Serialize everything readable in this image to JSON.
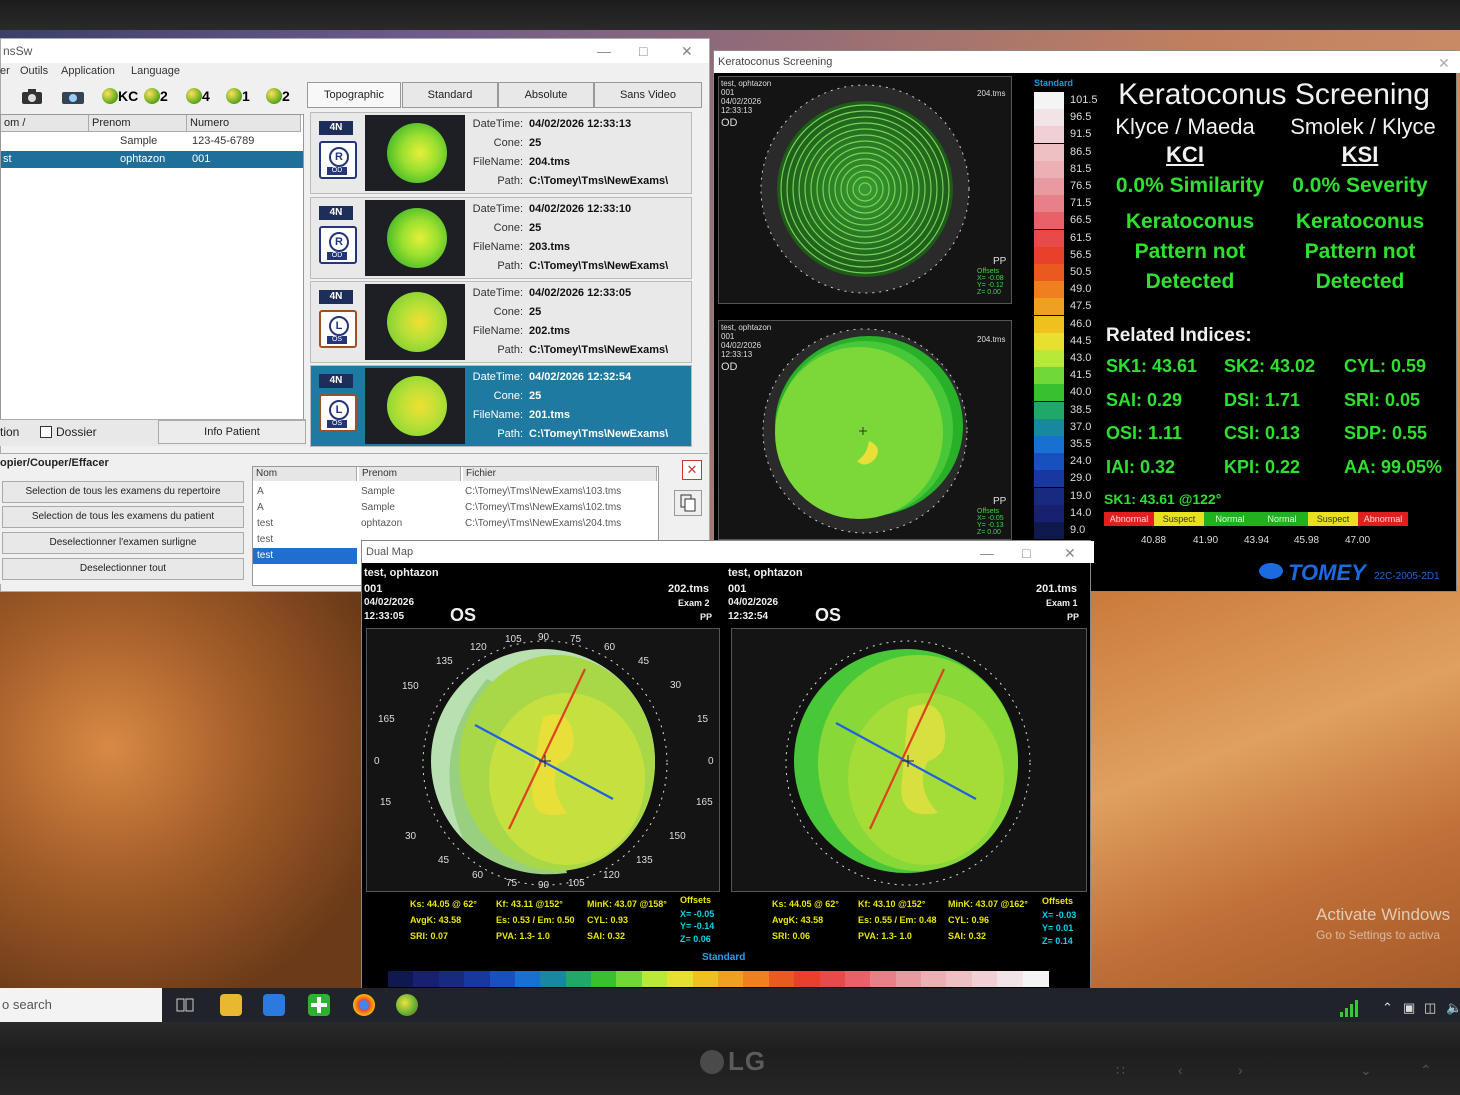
{
  "main_window": {
    "title": "nsSw",
    "menu": [
      "er",
      "Outils",
      "Application",
      "Language"
    ],
    "toolbar": [
      "KC",
      "2",
      "4",
      "1",
      "2"
    ],
    "patient_table": {
      "headers": [
        "om /",
        "Prenom",
        "Numero"
      ],
      "rows": [
        {
          "nom": "",
          "prenom": "Sample",
          "numero": "123-45-6789"
        },
        {
          "nom": "st",
          "prenom": "ophtazon",
          "numero": "001"
        }
      ]
    },
    "tabs": [
      "Topographic",
      "Standard",
      "Absolute",
      "Sans Video"
    ],
    "exams": [
      {
        "badge": "4N",
        "eye": "R",
        "side": "OD",
        "datetime": "04/02/2026 12:33:13",
        "cone": "25",
        "filename": "204.tms",
        "path": "C:\\Tomey\\Tms\\NewExams\\"
      },
      {
        "badge": "4N",
        "eye": "R",
        "side": "OD",
        "datetime": "04/02/2026 12:33:10",
        "cone": "25",
        "filename": "203.tms",
        "path": "C:\\Tomey\\Tms\\NewExams\\"
      },
      {
        "badge": "4N",
        "eye": "L",
        "side": "OS",
        "datetime": "04/02/2026 12:33:05",
        "cone": "25",
        "filename": "202.tms",
        "path": "C:\\Tomey\\Tms\\NewExams\\"
      },
      {
        "badge": "4N",
        "eye": "L",
        "side": "OS",
        "datetime": "04/02/2026 12:32:54",
        "cone": "25",
        "filename": "201.tms",
        "path": "C:\\Tomey\\Tms\\NewExams\\"
      }
    ],
    "exam_labels": {
      "datetime": "DateTime:",
      "cone": "Cone:",
      "filename": "FileName:",
      "path": "Path:"
    },
    "bottom_bar": {
      "left": "tion",
      "dossier": "Dossier",
      "info": "Info Patient"
    },
    "actions_title": "opier/Couper/Effacer",
    "actions": [
      "Selection de tous les examens du repertoire",
      "Selection de tous les examens du patient",
      "Deselectionner l'examen surligne",
      "Deselectionner tout"
    ],
    "file_table": {
      "headers": [
        "Nom",
        "Prenom",
        "Fichier"
      ],
      "rows": [
        {
          "nom": "A",
          "prenom": "Sample",
          "fichier": "C:\\Tomey\\Tms\\NewExams\\103.tms"
        },
        {
          "nom": "A",
          "prenom": "Sample",
          "fichier": "C:\\Tomey\\Tms\\NewExams\\102.tms"
        },
        {
          "nom": "test",
          "prenom": "ophtazon",
          "fichier": "C:\\Tomey\\Tms\\NewExams\\204.tms"
        },
        {
          "nom": "test",
          "prenom": "",
          "fichier": ""
        },
        {
          "nom": "test",
          "prenom": "",
          "fichier": ""
        }
      ]
    }
  },
  "ks_window": {
    "title": "Keratoconus Screening",
    "map_top": {
      "name": "test, ophtazon",
      "id": "001",
      "date": "04/02/2026",
      "time": "12:33:13",
      "eye": "OD",
      "file": "204.tms",
      "offsets": "Offsets",
      "x": "X= -0.08",
      "y": "Y= -0.12",
      "z": "Z= 0.00",
      "pp": "PP"
    },
    "map_bottom": {
      "name": "test, ophtazon",
      "id": "001",
      "date": "04/02/2026",
      "time": "12:33:13",
      "eye": "OD",
      "file": "204.tms",
      "offsets": "Offsets",
      "x": "X= -0.05",
      "y": "Y= -0.13",
      "z": "Z= 0.00",
      "pp": "PP"
    },
    "scale_label": "Standard",
    "scale_values": [
      "101.5",
      "96.5",
      "91.5",
      "86.5",
      "81.5",
      "76.5",
      "71.5",
      "66.5",
      "61.5",
      "56.5",
      "50.5",
      "49.0",
      "47.5",
      "46.0",
      "44.5",
      "43.0",
      "41.5",
      "40.0",
      "38.5",
      "37.0",
      "35.5",
      "24.0",
      "29.0",
      "19.0",
      "14.0",
      "9.0"
    ],
    "scale_colors": [
      "#f4f4f4",
      "#f2e4e6",
      "#f0d0d4",
      "#eec0c4",
      "#ecb0b4",
      "#e89aa0",
      "#e88088",
      "#e86068",
      "#e84a4a",
      "#e8402a",
      "#ea5a20",
      "#ee8020",
      "#f0a020",
      "#f0c020",
      "#e8e030",
      "#b8e838",
      "#70d838",
      "#38c030",
      "#20a868",
      "#1888a0",
      "#1870d0",
      "#1850c0",
      "#1838a0",
      "#182a80",
      "#182070",
      "#101850"
    ],
    "headline": "Keratoconus Screening",
    "left_col": {
      "title": "Klyce / Maeda",
      "index": "KCI",
      "pct": "0.0% Similarity",
      "l1": "Keratoconus",
      "l2": "Pattern not",
      "l3": "Detected"
    },
    "right_col": {
      "title": "Smolek / Klyce",
      "index": "KSI",
      "pct": "0.0% Severity",
      "l1": "Keratoconus",
      "l2": "Pattern not",
      "l3": "Detected"
    },
    "related_title": "Related Indices:",
    "indices": [
      [
        "SK1: 43.61",
        "SK2: 43.02",
        "CYL: 0.59"
      ],
      [
        "SAI: 0.29",
        "DSI: 1.71",
        "SRI: 0.05"
      ],
      [
        "OSI: 1.11",
        "CSI: 0.13",
        "SDP: 0.55"
      ],
      [
        "IAI: 0.32",
        "KPI: 0.22",
        "AA: 99.05%"
      ]
    ],
    "sk_line": "SK1: 43.61 @122°",
    "class_bar": [
      "Abnormal",
      "Suspect",
      "Normal",
      "Normal",
      "Suspect",
      "Abnormal"
    ],
    "class_values": [
      "40.88",
      "41.90",
      "43.94",
      "45.98",
      "47.00"
    ],
    "brand": "TOMEY",
    "version": "22C-2005-2D1"
  },
  "dual_window": {
    "title": "Dual Map",
    "left": {
      "name": "test, ophtazon",
      "id": "001",
      "date": "04/02/2026",
      "time": "12:33:05",
      "eye": "OS",
      "file": "202.tms",
      "exam": "Exam 2",
      "pp": "PP",
      "ks": "Ks: 44.05 @ 62°",
      "kf": "Kf: 43.11 @152°",
      "mink": "MinK: 43.07 @158°",
      "avgk": "AvgK: 43.58",
      "es": "Es: 0.53 / Em: 0.50",
      "cyl": "CYL: 0.93",
      "sri": "SRI: 0.07",
      "pva": "PVA:  1.3-  1.0",
      "sai": "SAI: 0.32",
      "offsets": "Offsets",
      "x": "X= -0.05",
      "y": "Y= -0.14",
      "z": "Z= 0.06"
    },
    "right": {
      "name": "test, ophtazon",
      "id": "001",
      "date": "04/02/2026",
      "time": "12:32:54",
      "eye": "OS",
      "file": "201.tms",
      "exam": "Exam 1",
      "pp": "PP",
      "ks": "Ks: 44.05 @ 62°",
      "kf": "Kf: 43.10 @152°",
      "mink": "MinK: 43.07 @162°",
      "avgk": "AvgK: 43.58",
      "es": "Es: 0.55 / Em: 0.48",
      "cyl": "CYL: 0.96",
      "sri": "SRI: 0.06",
      "pva": "PVA:  1.3-  1.0",
      "sai": "SAI: 0.32",
      "offsets": "Offsets",
      "x": "X= -0.03",
      "y": "Y= 0.01",
      "z": "Z= 0.14"
    },
    "scale_label": "Standard",
    "bar_colors": [
      "#101850",
      "#182070",
      "#182a80",
      "#1838a0",
      "#1850c0",
      "#1870d0",
      "#1888a0",
      "#20a868",
      "#38c030",
      "#70d838",
      "#b8e838",
      "#e8e030",
      "#f0c020",
      "#f0a020",
      "#ee8020",
      "#ea5a20",
      "#e8402a",
      "#e84a4a",
      "#e86068",
      "#e88088",
      "#e89aa0",
      "#ecb0b4",
      "#eec0c4",
      "#f0d0d4",
      "#f2e4e6",
      "#f4f4f4"
    ]
  },
  "axis_labels": [
    "0",
    "15",
    "30",
    "45",
    "60",
    "75",
    "90",
    "105",
    "120",
    "135",
    "150",
    "165",
    "0",
    "15",
    "30",
    "45",
    "60",
    "75",
    "90",
    "105",
    "120",
    "135",
    "150",
    "165"
  ],
  "desktop": {
    "activate1": "Activate Windows",
    "activate2": "Go to Settings to activa"
  },
  "taskbar": {
    "search": "o search"
  },
  "monitor": {
    "brand": "LG"
  }
}
